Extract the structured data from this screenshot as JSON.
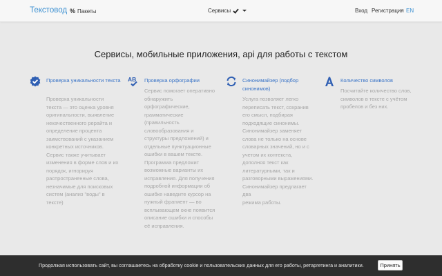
{
  "navbar": {
    "brand": "Текстовод",
    "packages_label": "Пакеты",
    "services_label": "Сервисы",
    "login_label": "Вход",
    "register_label": "Регистрация",
    "lang_label": "EN"
  },
  "headline": "Сервисы, мобильные приложения, api для работы с текстом",
  "features": [
    {
      "icon": "check-badge-icon",
      "title": "Проверка уникальности текста",
      "desc_lines": [
        "Проверка уникальности",
        "текста — это оценка уровня",
        "оригинальности, выявление",
        "некачественного рерайта и",
        "определение процента",
        "заимствований с указанием",
        "конкретных источников.",
        "Сервис также учитывает",
        "изменения в форме слов и их",
        "порядок, игнорируя",
        "распространенные слова,",
        "незначимые для поисковых",
        "систем (анализ \"воды\" в",
        "тексте)"
      ]
    },
    {
      "icon": "spellcheck-icon",
      "title": "Проверка орфографии",
      "desc_lines": [
        "Сервис помогает оперативно",
        "обнаружить",
        "орфографические,",
        "грамматические",
        "(правильность",
        "словообразования и",
        "структуры предложений) и",
        "отдельные пунктуационные",
        "ошибки в вашем тексте.",
        "Программа предложит",
        "возможные варианты их",
        "исправления. Для получения",
        "подробной информации об",
        "ошибке наведите курсор на",
        "нужный фрагмент — во",
        "всплывающем окне появится",
        "описание ошибки и способы",
        "её исправления."
      ]
    },
    {
      "icon": "refresh-icon",
      "title": "Синонимайзер (подбор синонимов)",
      "desc_lines": [
        "Услуга позволяет легко",
        "переписать текст, сохранив",
        "его смысл, подбирая",
        "подходящие синонимы.",
        "Синонимайзер заменяет",
        "слова не только на основе",
        "словарных значений, но и с",
        "учетом их контекста,",
        "дополняя текст как",
        "литературными, так и",
        "разговорными выражениями.",
        "Синонимайзер предлагает два",
        "режима работы."
      ]
    },
    {
      "icon": "font-icon",
      "title": "Количество символов",
      "desc_lines": [
        "Посчитайте количество слов,",
        "символов в тексте с учётом",
        "пробелов и без них."
      ]
    }
  ],
  "cookie": {
    "text": "Продолжая использовать сайт, вы соглашаетесь на обработку cookie и пользовательских данных для его работы, ретаргетинга и аналитики.",
    "accept_label": "Принять"
  },
  "colors": {
    "accent": "#3a74c7",
    "brand": "#3a8fd1",
    "icon": "#2f5fb3",
    "muted_text": "#a7a7a7",
    "cookie_bg": "#2e2e2e"
  }
}
